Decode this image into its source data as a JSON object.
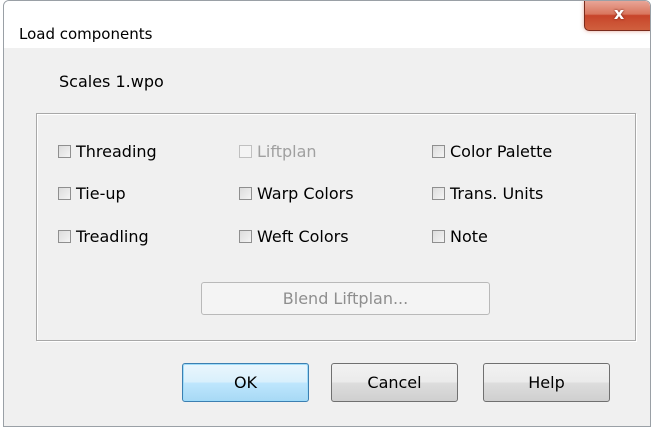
{
  "window": {
    "title": "Load components",
    "close_glyph": "x"
  },
  "file_name": "Scales 1.wpo",
  "components": {
    "threading": {
      "label": "Threading",
      "checked": false,
      "enabled": true
    },
    "liftplan": {
      "label": "Liftplan",
      "checked": false,
      "enabled": false
    },
    "color_palette": {
      "label": "Color Palette",
      "checked": false,
      "enabled": true
    },
    "tie_up": {
      "label": "Tie-up",
      "checked": false,
      "enabled": true
    },
    "warp_colors": {
      "label": "Warp Colors",
      "checked": false,
      "enabled": true
    },
    "trans_units": {
      "label": "Trans. Units",
      "checked": false,
      "enabled": true
    },
    "treadling": {
      "label": "Treadling",
      "checked": false,
      "enabled": true
    },
    "weft_colors": {
      "label": "Weft Colors",
      "checked": false,
      "enabled": true
    },
    "note": {
      "label": "Note",
      "checked": false,
      "enabled": true
    }
  },
  "blend_button": {
    "label": "Blend Liftplan...",
    "enabled": false
  },
  "buttons": {
    "ok": "OK",
    "cancel": "Cancel",
    "help": "Help"
  },
  "colors": {
    "close_button": "#c7442a",
    "default_button_border": "#3c7fb1",
    "disabled_text": "#a0a0a0"
  }
}
